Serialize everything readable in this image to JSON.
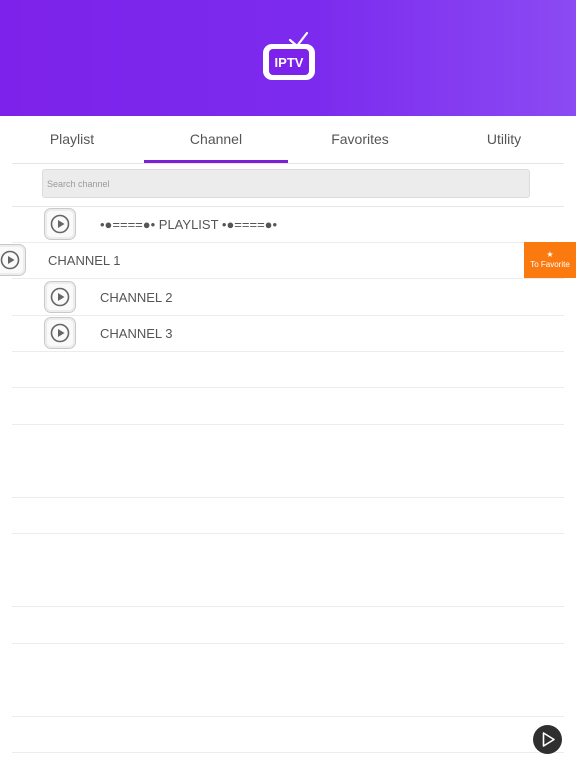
{
  "header": {
    "logo_text": "IPTV",
    "brand_color": "#7d22ea"
  },
  "tabs": [
    {
      "label": "Playlist",
      "active": false
    },
    {
      "label": "Channel",
      "active": true
    },
    {
      "label": "Favorites",
      "active": false
    },
    {
      "label": "Utility",
      "active": false
    }
  ],
  "search": {
    "placeholder": "Search channel",
    "value": ""
  },
  "list": {
    "playlist_header": "•●====●• PLAYLIST •●====●•",
    "channels": [
      {
        "label": "CHANNEL 1"
      },
      {
        "label": "CHANNEL 2"
      },
      {
        "label": "CHANNEL 3"
      }
    ]
  },
  "favorite_button": {
    "star": "★",
    "label": "To Favorite",
    "color": "#fb7a10"
  },
  "fab": {
    "icon": "play-icon"
  }
}
